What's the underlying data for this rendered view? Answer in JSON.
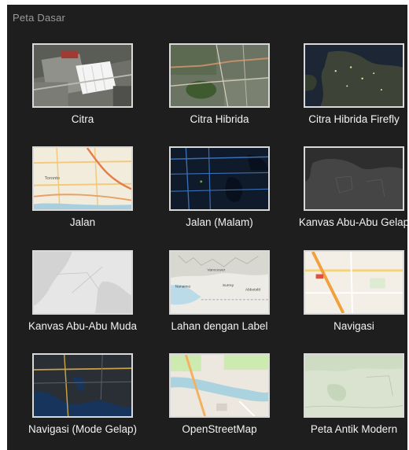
{
  "panel": {
    "title": "Peta Dasar"
  },
  "basemaps": [
    {
      "label": "Citra"
    },
    {
      "label": "Citra Hibrida"
    },
    {
      "label": "Citra Hibrida Firefly"
    },
    {
      "label": "Jalan"
    },
    {
      "label": "Jalan (Malam)"
    },
    {
      "label": "Kanvas Abu-Abu Gelap"
    },
    {
      "label": "Kanvas Abu-Abu Muda"
    },
    {
      "label": "Lahan dengan Label"
    },
    {
      "label": "Navigasi"
    },
    {
      "label": "Navigasi (Mode Gelap)"
    },
    {
      "label": "OpenStreetMap"
    },
    {
      "label": "Peta Antik Modern"
    }
  ],
  "thumb_labels": {
    "jalan": "Toronto",
    "lahan_1": "Vancouver",
    "lahan_2": "Nanaimo",
    "lahan_3": "Surrey",
    "lahan_4": "Abbotsfd"
  }
}
